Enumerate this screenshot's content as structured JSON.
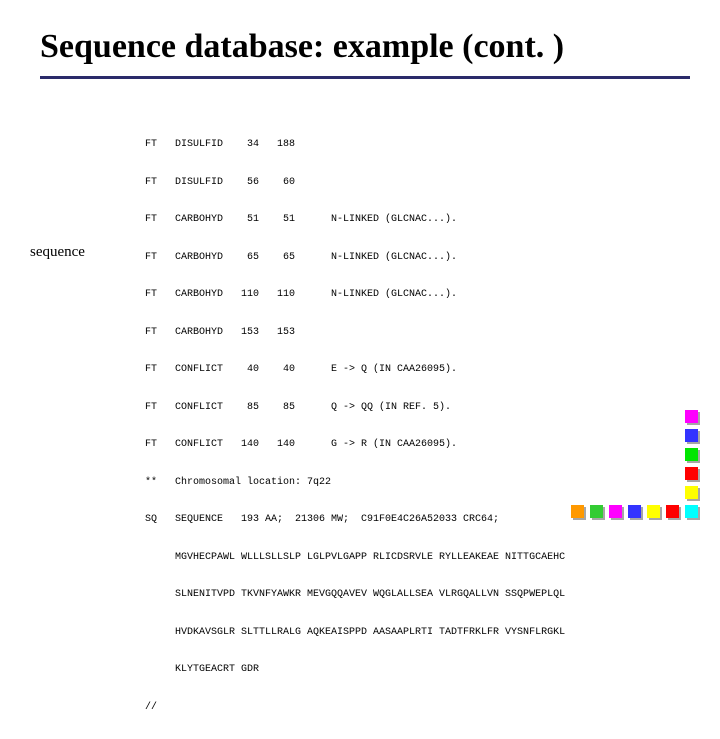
{
  "title": "Sequence database: example (cont. )",
  "label": "sequence",
  "ft_lines": [
    "FT   DISULFID    34   188",
    "FT   DISULFID    56    60",
    "FT   CARBOHYD    51    51      N-LINKED (GLCNAC...).",
    "FT   CARBOHYD    65    65      N-LINKED (GLCNAC...).",
    "FT   CARBOHYD   110   110      N-LINKED (GLCNAC...).",
    "FT   CARBOHYD   153   153",
    "FT   CONFLICT    40    40      E -> Q (IN CAA26095).",
    "FT   CONFLICT    85    85      Q -> QQ (IN REF. 5).",
    "FT   CONFLICT   140   140      G -> R (IN CAA26095).",
    "**   Chromosomal location: 7q22",
    "SQ   SEQUENCE   193 AA;  21306 MW;  C91F0E4C26A52033 CRC64;"
  ],
  "seq_lines": [
    "     MGVHECPAWL WLLLSLLSLP LGLPVLGAPP RLICDSRVLE RYLLEAKEAE NITTGCAEHC",
    "     SLNENITVPD TKVNFYAWKR MEVGQQAVEV WQGLALLSEA VLRGQALLVN SSQPWEPLQL",
    "     HVDKAVSGLR SLTTLLRALG AQKEAISPPD AASAAPLRTI TADTFRKLFR VYSNFLRGKL",
    "     KLYTGEACRT GDR",
    "//"
  ],
  "square_colors": {
    "col7": [
      "#ff00ff",
      "#3333ff",
      "#00e600",
      "#ff0000",
      "#ffff00",
      "#00ffff"
    ],
    "row6": [
      "#ff9900",
      "#33cc33",
      "#ff00ff",
      "#3333ff",
      "#ffff00",
      "#ff0000",
      "#00ffff"
    ]
  }
}
